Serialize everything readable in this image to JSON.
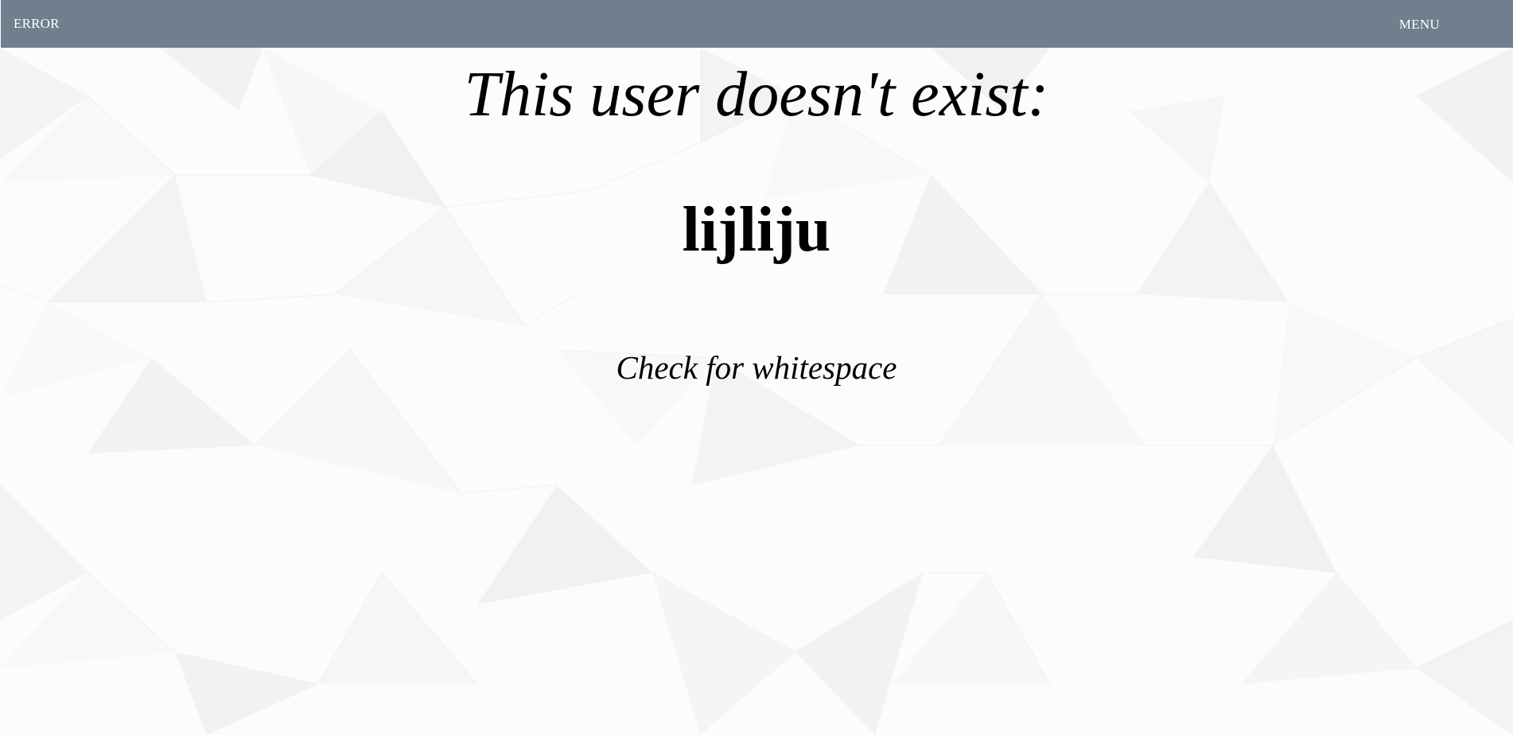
{
  "topbar": {
    "title": "ERROR",
    "menu_label": "MENU",
    "background_color": "#6f7f8e"
  },
  "main": {
    "headline": "This user doesn't exist:",
    "username": "lijliju",
    "hint": "Check for whitespace"
  }
}
